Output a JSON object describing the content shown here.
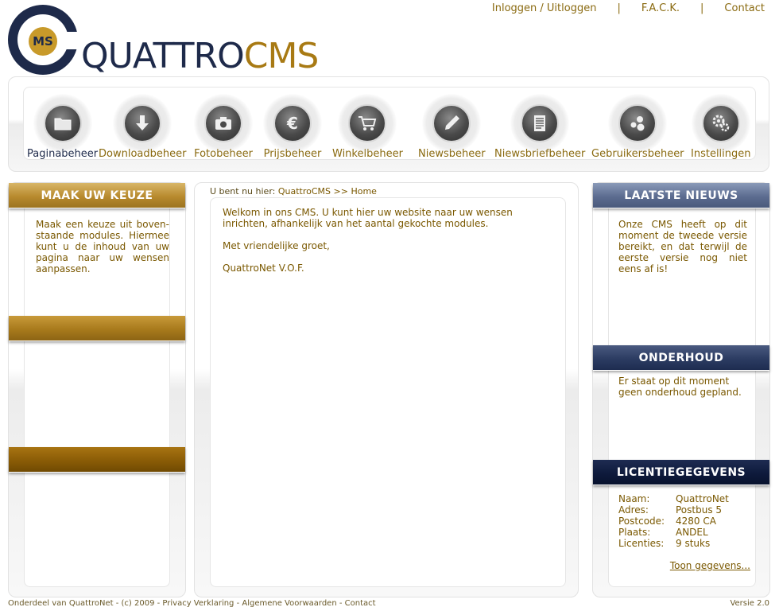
{
  "topnav": {
    "login": "Inloggen / Uitloggen",
    "sep": "|",
    "fack": "F.A.C.K.",
    "contact": "Contact"
  },
  "logo": {
    "ms": "MS",
    "quattro": "QUATTRO",
    "cms": "CMS"
  },
  "toolbar": {
    "items": [
      {
        "label": "Paginabeheer",
        "icon": "folder-icon"
      },
      {
        "label": "Downloadbeheer",
        "icon": "download-arrow-icon"
      },
      {
        "label": "Fotobeheer",
        "icon": "camera-icon"
      },
      {
        "label": "Prijsbeheer",
        "icon": "euro-icon"
      },
      {
        "label": "Winkelbeheer",
        "icon": "shopping-cart-icon"
      },
      {
        "label": "Niewsbeheer",
        "icon": "pen-icon"
      },
      {
        "label": "Niewsbriefbeheer",
        "icon": "document-icon"
      },
      {
        "label": "Gebruikersbeheer",
        "icon": "users-icon"
      },
      {
        "label": "Instellingen",
        "icon": "gears-icon"
      }
    ]
  },
  "left": {
    "title": "MAAK UW KEUZE",
    "text": "Maak een keuze uit boven-staande modules. Hiermee kunt u de inhoud van uw pagina naar uw wensen aanpassen."
  },
  "breadcrumb": {
    "prefix": "U bent nu hier:",
    "path": "QuattroCMS >> Home"
  },
  "main": {
    "p1": "Welkom in ons CMS. U kunt hier uw website naar uw wensen inrichten, afhankelijk van het aantal gekochte modules.",
    "p2": "Met vriendelijke groet,",
    "p3": "QuattroNet V.O.F."
  },
  "right": {
    "news_title": "LAATSTE NIEUWS",
    "news_text": "Onze CMS heeft op dit moment de tweede versie bereikt, en dat terwijl de eerste versie nog niet eens af is!",
    "maint_title": "ONDERHOUD",
    "maint_text": "Er staat op dit moment geen onderhoud gepland.",
    "license_title": "LICENTIEGEGEVENS",
    "license": [
      {
        "key": "Naam:",
        "value": "QuattroNet"
      },
      {
        "key": "Adres:",
        "value": "Postbus 5"
      },
      {
        "key": "Postcode:",
        "value": "4280 CA"
      },
      {
        "key": "Plaats:",
        "value": "ANDEL"
      },
      {
        "key": "Licenties:",
        "value": "9 stuks"
      }
    ],
    "show_link": "Toon gegevens..."
  },
  "footer": {
    "left": "Onderdeel van QuattroNet - (c) 2009 - Privacy Verklaring - Algemene Voorwaarden - Contact",
    "right": "Versie 2.0"
  },
  "colors": {
    "gold": "#7a5800",
    "navy": "#1e2a4a"
  }
}
